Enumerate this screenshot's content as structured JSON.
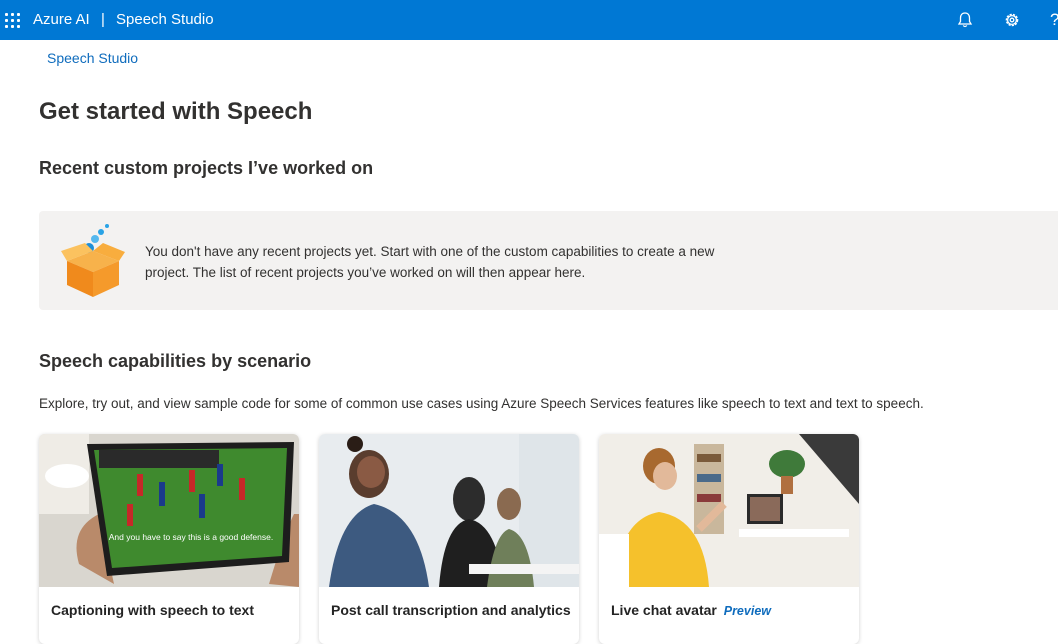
{
  "header": {
    "brand": "Azure AI",
    "separator": "|",
    "product": "Speech Studio",
    "help_glyph": "?",
    "icons": [
      "app-launcher-icon",
      "bell-icon",
      "gear-icon",
      "help-icon"
    ]
  },
  "breadcrumb": "Speech Studio",
  "page_title": "Get started with Speech",
  "recent": {
    "title": "Recent custom projects I’ve worked on",
    "empty_line1": "You don't have any recent projects yet. Start with one of the custom capabilities to create a new",
    "empty_line2": "project. The list of recent projects you’ve worked on will then appear here."
  },
  "capabilities": {
    "title": "Speech capabilities by scenario",
    "description": "Explore, try out, and view sample code for some of common use cases using Azure Speech Services features like speech to text and text to speech.",
    "cards": [
      {
        "label": "Captioning with speech to text",
        "caption": "And you have to say this is a good defense."
      },
      {
        "label": "Post call transcription and analytics"
      },
      {
        "label": "Live chat avatar",
        "badge": "Preview"
      }
    ]
  },
  "colors": {
    "header": "#0078d4",
    "link": "#0f6cbd",
    "panel": "#f3f2f1"
  }
}
